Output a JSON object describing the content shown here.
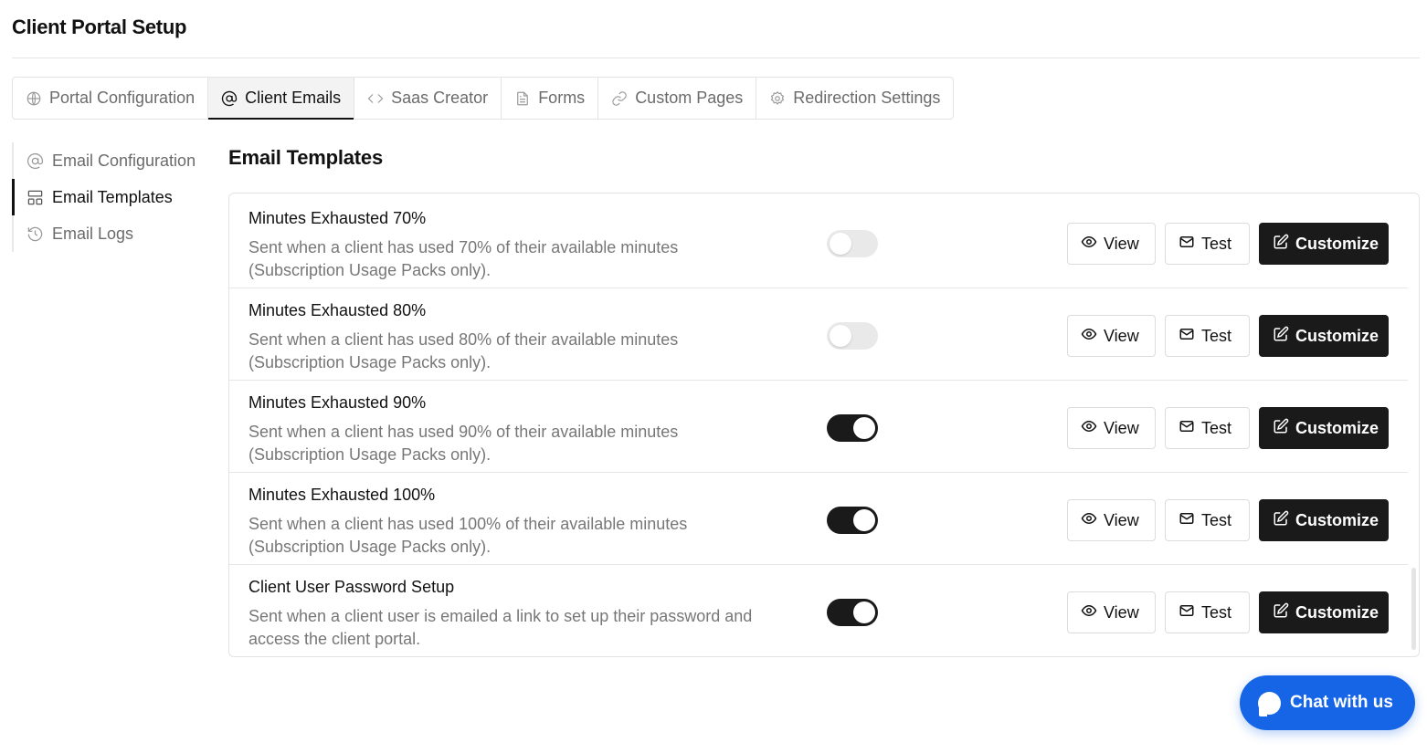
{
  "page": {
    "title": "Client Portal Setup"
  },
  "tabs": [
    {
      "label": "Portal Configuration",
      "icon": "globe-icon",
      "active": false
    },
    {
      "label": "Client Emails",
      "icon": "at-sign-icon",
      "active": true
    },
    {
      "label": "Saas Creator",
      "icon": "code-icon",
      "active": false
    },
    {
      "label": "Forms",
      "icon": "document-icon",
      "active": false
    },
    {
      "label": "Custom Pages",
      "icon": "link-icon",
      "active": false
    },
    {
      "label": "Redirection Settings",
      "icon": "gear-icon",
      "active": false
    }
  ],
  "sidebar": {
    "items": [
      {
        "label": "Email Configuration",
        "icon": "at-sign-icon",
        "active": false
      },
      {
        "label": "Email Templates",
        "icon": "layout-icon",
        "active": true
      },
      {
        "label": "Email Logs",
        "icon": "history-icon",
        "active": false
      }
    ]
  },
  "main": {
    "section_title": "Email Templates",
    "templates": [
      {
        "name": "Minutes Exhausted 70%",
        "desc_line1": "Sent when a client has used 70% of their available minutes",
        "desc_line2": "(Subscription Usage Packs only).",
        "enabled": false
      },
      {
        "name": "Minutes Exhausted 80%",
        "desc_line1": "Sent when a client has used 80% of their available minutes",
        "desc_line2": "(Subscription Usage Packs only).",
        "enabled": false
      },
      {
        "name": "Minutes Exhausted 90%",
        "desc_line1": "Sent when a client has used 90% of their available minutes",
        "desc_line2": "(Subscription Usage Packs only).",
        "enabled": true
      },
      {
        "name": "Minutes Exhausted 100%",
        "desc_line1": "Sent when a client has used 100% of their available minutes",
        "desc_line2": "(Subscription Usage Packs only).",
        "enabled": true
      },
      {
        "name": "Client User Password Setup",
        "desc_line1": "Sent when a client user is emailed a link to set up their password and",
        "desc_line2": "access the client portal.",
        "enabled": true
      }
    ],
    "actions": {
      "view_label": "View",
      "test_label": "Test",
      "customize_label": "Customize",
      "view_icon": "eye-icon",
      "test_icon": "mail-icon",
      "customize_icon": "edit-icon"
    }
  },
  "chat": {
    "label": "Chat with us",
    "icon": "chat-bubble-icon"
  },
  "colors": {
    "accent": "#1565e6",
    "primary_button": "#1a1a1a",
    "muted_text": "#777777"
  }
}
